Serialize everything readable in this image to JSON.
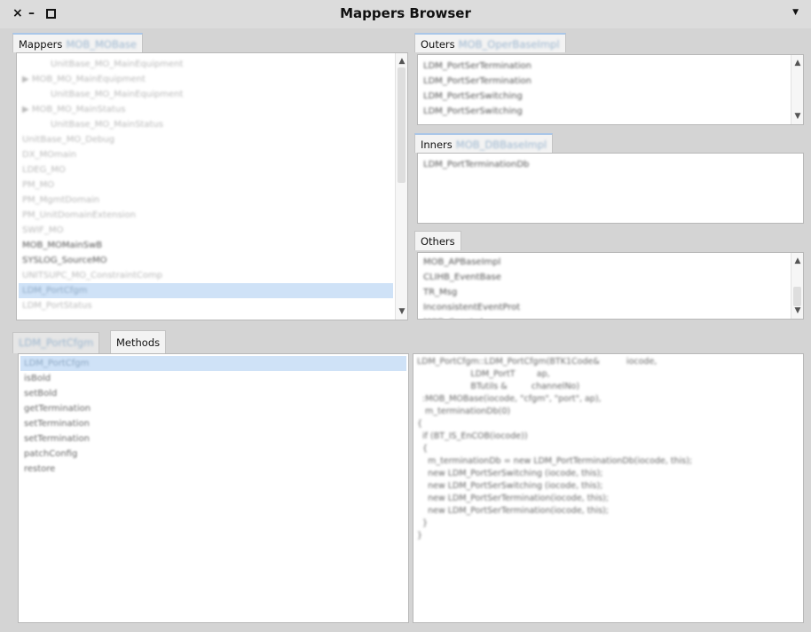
{
  "window": {
    "title": "Mappers Browser",
    "controls": {
      "close": "×",
      "minimize": "–",
      "menu": "▼"
    }
  },
  "mappers": {
    "tab_label": "Mappers",
    "tab_value": "MOB_MOBase",
    "items": [
      {
        "label": "UnitBase_MO_MainEquipment",
        "indent": true,
        "style": "faded"
      },
      {
        "label": "▶ MOB_MO_MainEquipment",
        "indent": false,
        "style": "faded"
      },
      {
        "label": "UnitBase_MO_MainEquipment",
        "indent": true,
        "style": "faded"
      },
      {
        "label": "▶ MOB_MO_MainStatus",
        "indent": false,
        "style": "faded"
      },
      {
        "label": "UnitBase_MO_MainStatus",
        "indent": true,
        "style": "faded"
      },
      {
        "label": "UnitBase_MO_Debug",
        "indent": false,
        "style": "faded"
      },
      {
        "label": "DX_MOmain",
        "indent": false,
        "style": "faded"
      },
      {
        "label": "LDEG_MO",
        "indent": false,
        "style": "faded"
      },
      {
        "label": "PM_MO",
        "indent": false,
        "style": "faded"
      },
      {
        "label": "PM_MgmtDomain",
        "indent": false,
        "style": "faded"
      },
      {
        "label": "PM_UnitDomainExtension",
        "indent": false,
        "style": "faded"
      },
      {
        "label": "SWIF_MO",
        "indent": false,
        "style": "faded"
      },
      {
        "label": "MOB_MOMainSwB",
        "indent": false,
        "style": "dark"
      },
      {
        "label": "SYSLOG_SourceMO",
        "indent": false,
        "style": "dark"
      },
      {
        "label": "UNITSUPC_MO_ConstraintComp",
        "indent": false,
        "style": "faded"
      },
      {
        "label": "LDM_PortCfgm",
        "indent": false,
        "style": "selected"
      },
      {
        "label": "LDM_PortStatus",
        "indent": false,
        "style": "faded"
      }
    ]
  },
  "outers": {
    "tab_label": "Outers",
    "tab_value": "MOB_OperBaseImpl",
    "items": [
      "LDM_PortSerTermination",
      "LDM_PortSerTermination",
      "LDM_PortSerSwitching",
      "LDM_PortSerSwitching"
    ]
  },
  "inners": {
    "tab_label": "Inners",
    "tab_value": "MOB_DBBaseImpl",
    "items": [
      "LDM_PortTerminationDb"
    ]
  },
  "others": {
    "tab_label": "Others",
    "items": [
      "MOB_APBaseImpl",
      "CLIHB_EventBase",
      "TR_Msg",
      "InconsistentEventProt",
      "MOB_Constrd"
    ]
  },
  "bottom": {
    "tab_class": "LDM_PortCfgm",
    "tab_methods": "Methods",
    "methods": [
      "LDM_PortCfgm",
      "isBold",
      "setBold",
      "getTermination",
      "setTermination",
      "setTermination",
      "patchConfig",
      "restore"
    ],
    "code": "LDM_PortCfgm::LDM_PortCfgm(BTK1Code&          iocode,\n                    LDM_PortT        ap,\n                    BTutils &         channelNo)\n  :MOB_MOBase(iocode, \"cfgm\", \"port\", ap),\n   m_terminationDb(0)\n{\n  if (BT_IS_EnCOB(iocode))\n  {\n    m_terminationDb = new LDM_PortTerminationDb(iocode, this);\n    new LDM_PortSerSwitching (iocode, this);\n    new LDM_PortSerSwitching (iocode, this);\n    new LDM_PortSerTermination(iocode, this);\n    new LDM_PortSerTermination(iocode, this);\n  }\n}"
  }
}
